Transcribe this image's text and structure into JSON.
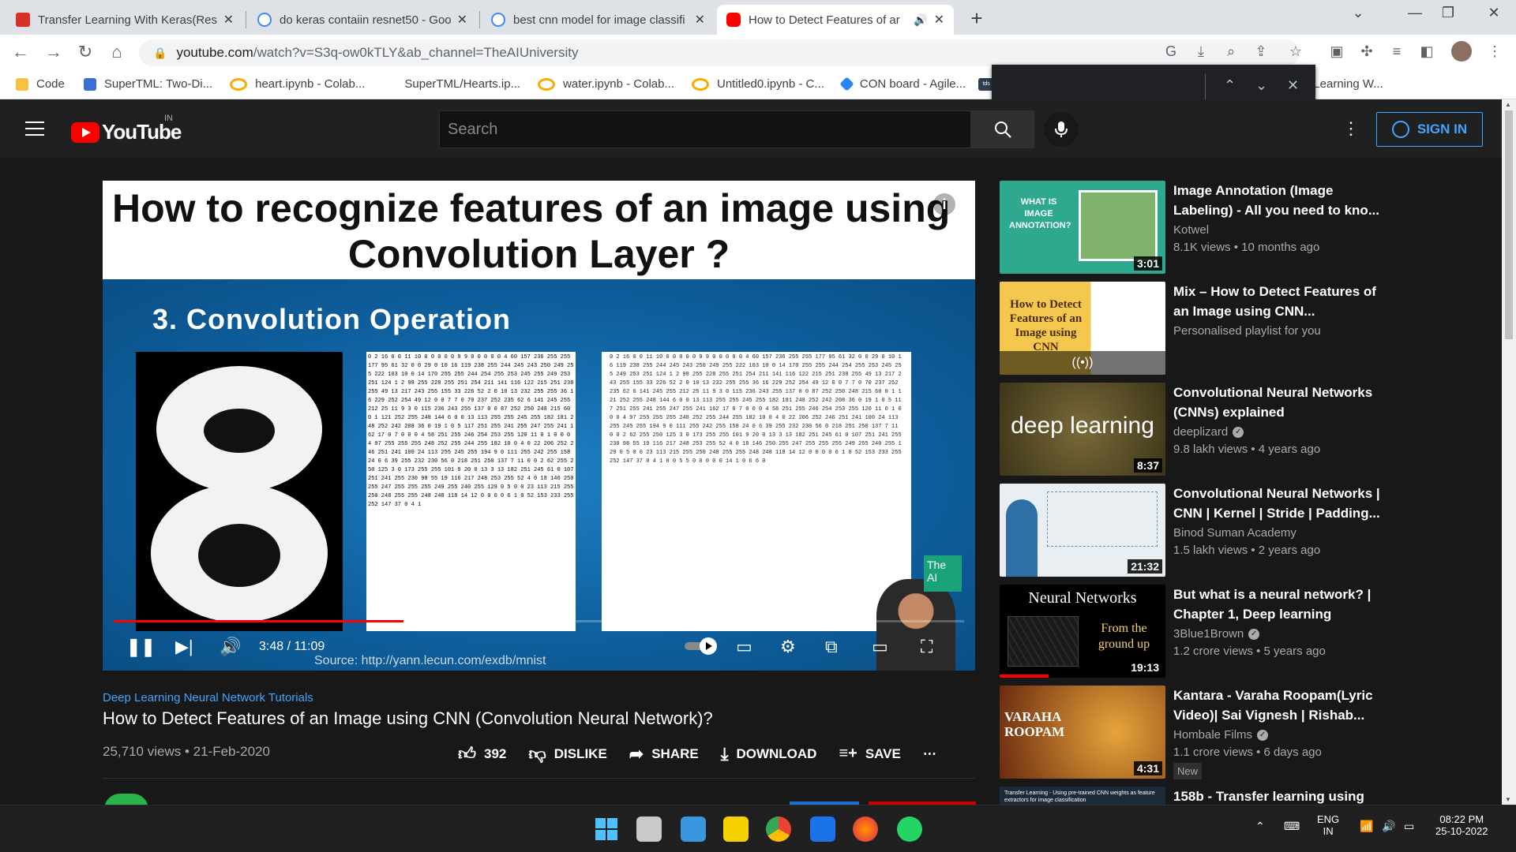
{
  "browser": {
    "tabs": [
      {
        "title": "Transfer Learning With Keras(Res",
        "active": false
      },
      {
        "title": "do keras contaiin resnet50 - Goo",
        "active": false
      },
      {
        "title": "best cnn model for image classifi",
        "active": false
      },
      {
        "title": "How to Detect Features of ar",
        "active": true
      }
    ],
    "url_host": "youtube.com",
    "url_rest": "/watch?v=S3q-ow0kTLY&ab_channel=TheAIUniversity",
    "bookmarks": [
      {
        "label": "Code",
        "icon": "folder-icon",
        "color": "#f5c242"
      },
      {
        "label": "SuperTML: Two-Di...",
        "icon": "bookmark-icon",
        "color": "#3b6fd6"
      },
      {
        "label": "heart.ipynb - Colab...",
        "icon": "colab-icon",
        "color": "#f9ab00"
      },
      {
        "label": "SuperTML/Hearts.ip...",
        "icon": "",
        "color": ""
      },
      {
        "label": "water.ipynb - Colab...",
        "icon": "colab-icon",
        "color": "#f9ab00"
      },
      {
        "label": "Untitled0.ipynb - C...",
        "icon": "colab-icon",
        "color": "#f9ab00"
      },
      {
        "label": "CON board - Agile...",
        "icon": "jira-icon",
        "color": "#2684ff"
      },
      {
        "label": "tds",
        "icon": "tds-icon",
        "color": "#2d3e50"
      },
      {
        "label": "sfer Learning W...",
        "icon": "",
        "color": ""
      }
    ]
  },
  "youtube": {
    "country": "IN",
    "logo_text": "YouTube",
    "search_placeholder": "Search",
    "sign_in": "SIGN IN",
    "video": {
      "slide_line1": "How to recognize features of an image using",
      "slide_line2": "Convolution Layer ?",
      "slide_heading": "3. Convolution Operation",
      "slide_source": "Source: http://yann.lecun.com/exdb/mnist",
      "time": "3:48 / 11:09",
      "progress": 0.341
    },
    "playlist": "Deep Learning Neural Network Tutorials",
    "title": "How to Detect Features of an Image using CNN (Convolution Neural Network)?",
    "views_date": "25,710 views • 21-Feb-2020",
    "actions": {
      "likes": "392",
      "dislike": "DISLIKE",
      "share": "SHARE",
      "download": "DOWNLOAD",
      "save": "SAVE"
    },
    "recommendations": [
      {
        "title": "Image Annotation (Image Labeling) - All you need to kno...",
        "channel": "Kotwel",
        "verified": false,
        "meta": "8.1K views • 10 months ago",
        "duration": "3:01",
        "thumb_text": "WHAT IS IMAGE ANNOTATION?",
        "badge": ""
      },
      {
        "title": "Mix – How to Detect Features of an Image using CNN...",
        "channel": "Personalised playlist for you",
        "verified": false,
        "meta": "",
        "duration": "",
        "thumb_text": "How to Detect Features of an Image using CNN",
        "badge": ""
      },
      {
        "title": "Convolutional Neural Networks (CNNs) explained",
        "channel": "deeplizard",
        "verified": true,
        "meta": "9.8 lakh views • 4 years ago",
        "duration": "8:37",
        "thumb_text": "deep learning",
        "badge": ""
      },
      {
        "title": "Convolutional Neural Networks | CNN | Kernel | Stride | Padding...",
        "channel": "Binod Suman Academy",
        "verified": false,
        "meta": "1.5 lakh views • 2 years ago",
        "duration": "21:32",
        "thumb_text": "",
        "badge": ""
      },
      {
        "title": "But what is a neural network? | Chapter 1, Deep learning",
        "channel": "3Blue1Brown",
        "verified": true,
        "meta": "1.2 crore views • 5 years ago",
        "duration": "19:13",
        "thumb_text": "Neural Networks",
        "thumb_text2": "From the ground up",
        "badge": ""
      },
      {
        "title": "Kantara - Varaha Roopam(Lyric Video)| Sai Vignesh | Rishab...",
        "channel": "Hombale Films",
        "verified": true,
        "meta": "1.1 crore views • 6 days ago",
        "duration": "4:31",
        "thumb_text": "VARAHA ROOPAM",
        "badge": "New"
      },
      {
        "title": "158b - Transfer learning using",
        "channel": "",
        "verified": false,
        "meta": "",
        "duration": "",
        "thumb_text": "Transfer Learning - Using pre-trained CNN weights as feature extractors for image classification",
        "badge": ""
      }
    ]
  },
  "taskbar": {
    "lang1": "ENG",
    "lang2": "IN",
    "time": "08:22 PM",
    "date": "25-10-2022"
  }
}
